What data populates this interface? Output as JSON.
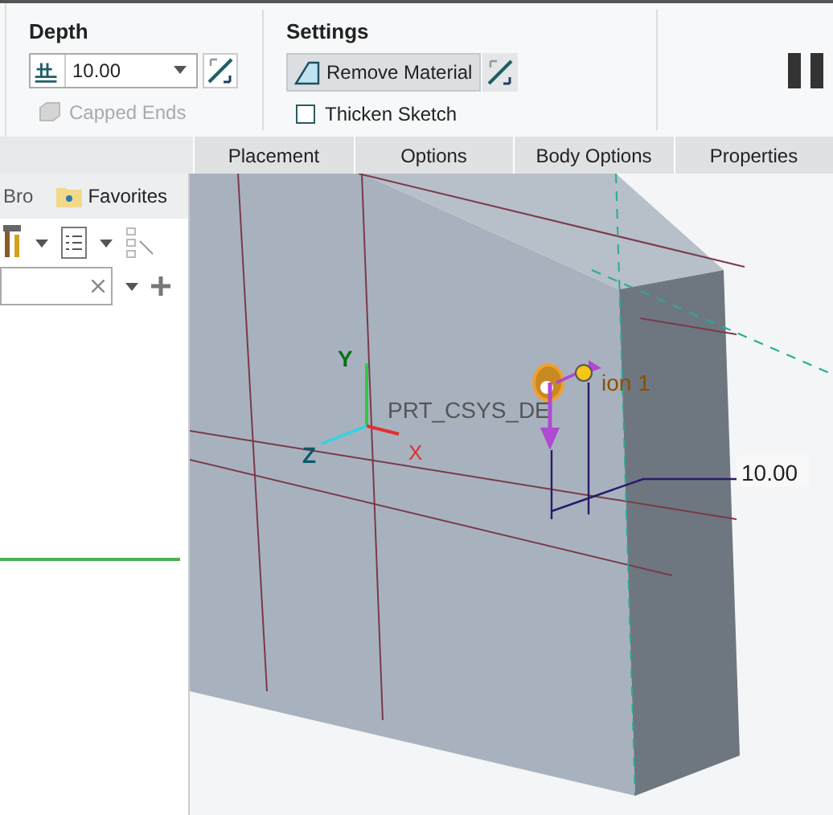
{
  "ribbon": {
    "depth": {
      "title": "Depth",
      "value": "10.00",
      "capped_ends": {
        "label": "Capped Ends",
        "disabled": true,
        "checked": false
      }
    },
    "settings": {
      "title": "Settings",
      "remove_material": {
        "label": "Remove Material",
        "selected": true
      },
      "thicken_sketch": {
        "label": "Thicken Sketch",
        "checked": false
      }
    }
  },
  "tabs": [
    {
      "label": "Placement",
      "selected": false
    },
    {
      "label": "Options",
      "selected": false
    },
    {
      "label": "Body Options",
      "selected": false
    },
    {
      "label": "Properties",
      "selected": false
    }
  ],
  "left_panel": {
    "tabs": [
      {
        "label": "Bro",
        "selected": false
      },
      {
        "label": "Favorites",
        "selected": false
      }
    ]
  },
  "viewport": {
    "csys_label": "PRT_CSYS_DE",
    "axes": [
      "Y",
      "Z",
      "X"
    ],
    "section_label": "ion 1",
    "dimension": "10.00"
  }
}
